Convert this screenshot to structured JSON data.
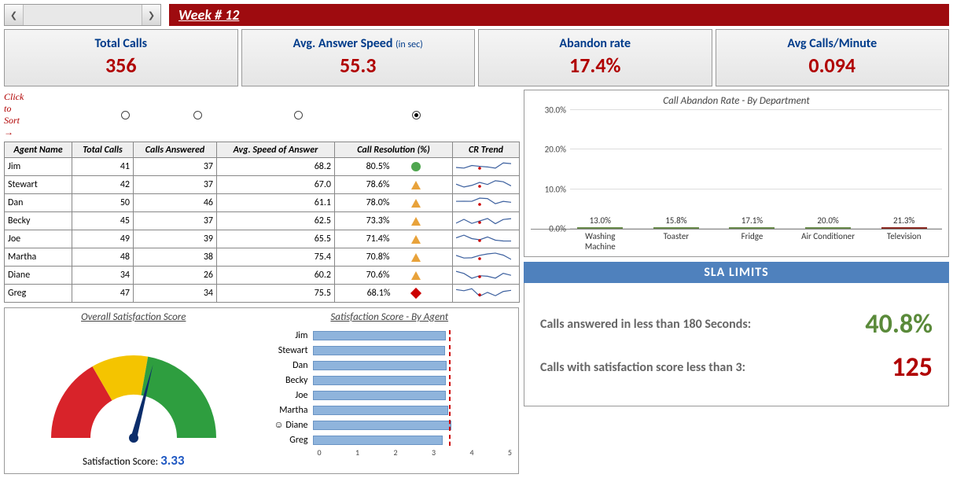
{
  "header": {
    "week_label": "Week # 12"
  },
  "kpi": [
    {
      "title": "Total Calls",
      "sub": "",
      "value": "356"
    },
    {
      "title": "Avg. Answer Speed",
      "sub": "(in sec)",
      "value": "55.3"
    },
    {
      "title": "Abandon rate",
      "sub": "",
      "value": "17.4%"
    },
    {
      "title": "Avg Calls/Minute",
      "sub": "",
      "value": "0.094"
    }
  ],
  "sort_hint": "Click to Sort",
  "table": {
    "headers": [
      "Agent Name",
      "Total Calls",
      "Calls Answered",
      "Avg. Speed of Answer",
      "Call Resolution (%)",
      "CR Trend"
    ],
    "sort_selected": 4,
    "rows": [
      {
        "name": "Jim",
        "calls": 41,
        "answered": 37,
        "speed": "68.2",
        "res": "80.5%",
        "ind": "green"
      },
      {
        "name": "Stewart",
        "calls": 42,
        "answered": 37,
        "speed": "67.0",
        "res": "78.6%",
        "ind": "yellow"
      },
      {
        "name": "Dan",
        "calls": 50,
        "answered": 46,
        "speed": "61.1",
        "res": "78.0%",
        "ind": "yellow"
      },
      {
        "name": "Becky",
        "calls": 45,
        "answered": 37,
        "speed": "62.5",
        "res": "73.3%",
        "ind": "yellow"
      },
      {
        "name": "Joe",
        "calls": 49,
        "answered": 39,
        "speed": "65.5",
        "res": "71.4%",
        "ind": "yellow"
      },
      {
        "name": "Martha",
        "calls": 48,
        "answered": 38,
        "speed": "75.4",
        "res": "70.8%",
        "ind": "yellow"
      },
      {
        "name": "Diane",
        "calls": 34,
        "answered": 26,
        "speed": "60.2",
        "res": "70.6%",
        "ind": "yellow"
      },
      {
        "name": "Greg",
        "calls": 47,
        "answered": 34,
        "speed": "75.5",
        "res": "68.1%",
        "ind": "red"
      }
    ]
  },
  "gauge": {
    "title": "Overall Satisfaction Score",
    "label": "Satisfaction Score:",
    "value": "3.33"
  },
  "sat_agent": {
    "title": "Satisfaction Score - By Agent",
    "max": 5,
    "target": 3.4,
    "rows": [
      {
        "name": "Jim",
        "score": 3.32,
        "smile": false
      },
      {
        "name": "Stewart",
        "score": 3.3,
        "smile": false
      },
      {
        "name": "Dan",
        "score": 3.33,
        "smile": false
      },
      {
        "name": "Becky",
        "score": 3.31,
        "smile": false
      },
      {
        "name": "Joe",
        "score": 3.32,
        "smile": false
      },
      {
        "name": "Martha",
        "score": 3.38,
        "smile": false
      },
      {
        "name": "Diane",
        "score": 3.46,
        "smile": true
      },
      {
        "name": "Greg",
        "score": 3.23,
        "smile": false
      }
    ],
    "axis": [
      "0",
      "1",
      "2",
      "3",
      "4",
      "5"
    ]
  },
  "chart_data": {
    "type": "bar",
    "title": "Call Abandon Rate - By Department",
    "categories": [
      "Washing Machine",
      "Toaster",
      "Fridge",
      "Air Conditioner",
      "Television"
    ],
    "values": [
      13.0,
      15.8,
      17.1,
      20.0,
      21.3
    ],
    "colors": [
      "green",
      "green",
      "green",
      "green",
      "red"
    ],
    "ylabel": "",
    "xlabel": "",
    "ylim": [
      0,
      30
    ],
    "yticks": [
      0,
      10,
      20,
      30
    ],
    "value_suffix": "%"
  },
  "sla": {
    "header": "SLA LIMITS",
    "row1_label": "Calls answered in less than 180 Seconds:",
    "row1_value": "40.8%",
    "row2_label": "Calls with satisfaction score less than 3:",
    "row2_value": "125"
  }
}
